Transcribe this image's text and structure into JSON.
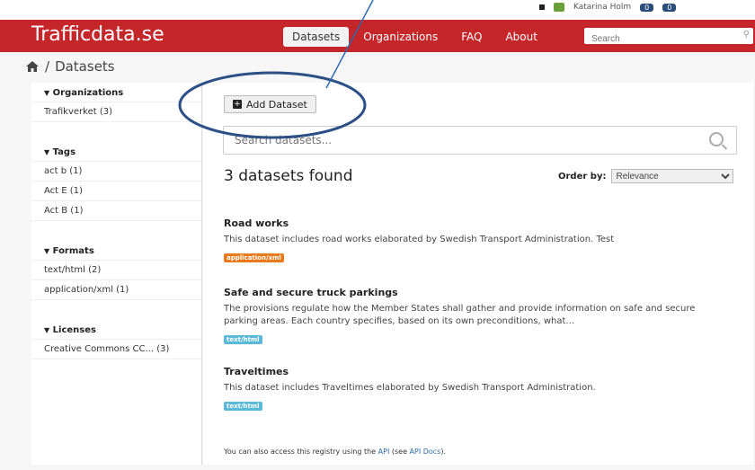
{
  "topbar": {
    "user_name": "Katarina Holm",
    "badge_a": "0",
    "badge_b": "0"
  },
  "header": {
    "brand": "Trafficdata.se",
    "nav": [
      "Datasets",
      "Organizations",
      "FAQ",
      "About"
    ],
    "search_placeholder": "Search"
  },
  "breadcrumb": {
    "separator": "/",
    "current": "Datasets"
  },
  "sidebar": {
    "organizations": {
      "title": "Organizations",
      "items": [
        "Trafikverket (3)"
      ]
    },
    "tags": {
      "title": "Tags",
      "items": [
        "act b (1)",
        "Act E (1)",
        "Act B (1)"
      ]
    },
    "formats": {
      "title": "Formats",
      "items": [
        "text/html (2)",
        "application/xml (1)"
      ]
    },
    "licenses": {
      "title": "Licenses",
      "items": [
        "Creative Commons CC... (3)"
      ]
    }
  },
  "main": {
    "add_button": "Add Dataset",
    "search_placeholder": "Search datasets...",
    "found_text": "3 datasets found",
    "order_label": "Order by:",
    "order_value": "Relevance",
    "datasets": [
      {
        "title": "Road works",
        "desc": "This dataset includes road works elaborated by Swedish Transport Administration. Test",
        "format": "application/xml"
      },
      {
        "title": "Safe and secure truck parkings",
        "desc": "The provisions regulate how the Member States shall gather and provide information on safe and secure parking areas. Each country specifies, based on its own preconditions, what...",
        "format": "text/html"
      },
      {
        "title": "Traveltimes",
        "desc": "This dataset includes Traveltimes elaborated by Swedish Transport Administration.",
        "format": "text/html"
      }
    ],
    "footer_prefix": "You can also access this registry using the ",
    "footer_api": "API",
    "footer_mid": " (see ",
    "footer_docs": "API Docs",
    "footer_suffix": ")."
  },
  "colors": {
    "header": "#c4262a",
    "xml_tag": "#e87a1c",
    "html_tag": "#5ab8d8",
    "annotation": "#2c4f86"
  },
  "icons": [
    "home-icon",
    "funnel-icon",
    "plus-icon",
    "search-icon",
    "user-avatar-icon"
  ]
}
